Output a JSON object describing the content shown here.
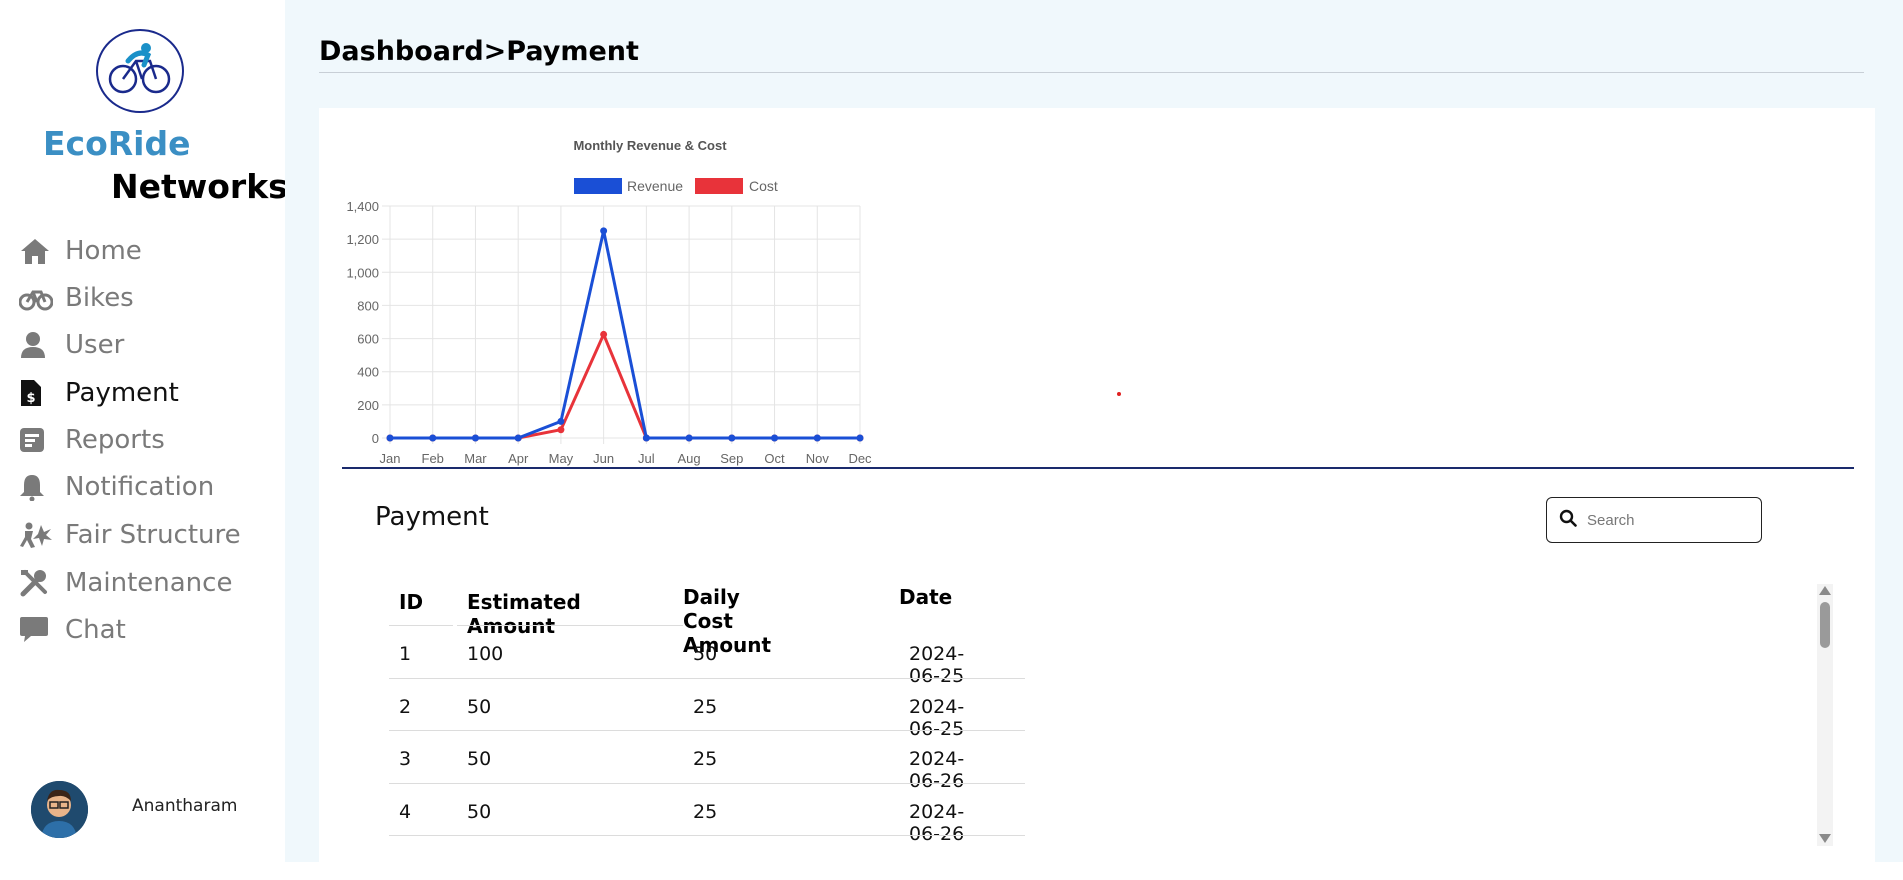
{
  "sidebar": {
    "brand_line1": "EcoRide",
    "brand_line2": "Networks",
    "items": [
      {
        "label": "Home",
        "icon": "home-icon"
      },
      {
        "label": "Bikes",
        "icon": "bike-icon"
      },
      {
        "label": "User",
        "icon": "user-icon"
      },
      {
        "label": "Payment",
        "icon": "payment-file-icon",
        "active": true
      },
      {
        "label": "Reports",
        "icon": "report-icon"
      },
      {
        "label": "Notification",
        "icon": "bell-icon"
      },
      {
        "label": "Fair Structure",
        "icon": "fair-structure-icon"
      },
      {
        "label": "Maintenance",
        "icon": "tools-icon"
      },
      {
        "label": "Chat",
        "icon": "chat-icon"
      }
    ],
    "user_name": "Anantharam"
  },
  "header": {
    "breadcrumb": "Dashboard>Payment"
  },
  "colors": {
    "brand_blue": "#3b8fc4",
    "main_bg": "#f0f8fc",
    "revenue": "#1a4fd6",
    "cost": "#e8333a",
    "divider": "#1a2a6c"
  },
  "chart_data": {
    "type": "line",
    "title": "Monthly Revenue & Cost",
    "categories": [
      "Jan",
      "Feb",
      "Mar",
      "Apr",
      "May",
      "Jun",
      "Jul",
      "Aug",
      "Sep",
      "Oct",
      "Nov",
      "Dec"
    ],
    "series": [
      {
        "name": "Revenue",
        "values": [
          0,
          0,
          0,
          0,
          100,
          1250,
          0,
          0,
          0,
          0,
          0,
          0
        ]
      },
      {
        "name": "Cost",
        "values": [
          0,
          0,
          0,
          0,
          50,
          625,
          0,
          0,
          0,
          0,
          0,
          0
        ]
      }
    ],
    "ylim": [
      0,
      1400
    ],
    "yticks": [
      "0",
      "200",
      "400",
      "600",
      "800",
      "1,000",
      "1,200",
      "1,400"
    ],
    "xlabel": "",
    "ylabel": "",
    "grid": true,
    "legend": "top"
  },
  "payment": {
    "title": "Payment",
    "search_placeholder": "Search",
    "columns": [
      "ID",
      "Estimated Amount",
      "Daily Cost Amount",
      "Date"
    ],
    "rows": [
      [
        "1",
        "100",
        "50",
        "2024-06-25"
      ],
      [
        "2",
        "50",
        "25",
        "2024-06-25"
      ],
      [
        "3",
        "50",
        "25",
        "2024-06-26"
      ],
      [
        "4",
        "50",
        "25",
        "2024-06-26"
      ]
    ]
  }
}
